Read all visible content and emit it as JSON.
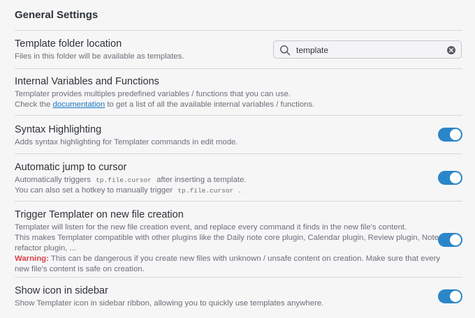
{
  "section": {
    "title": "General Settings"
  },
  "template_folder": {
    "name": "Template folder location",
    "desc": "Files in this folder will be available as templates.",
    "search_value": "template",
    "search_icon": "search-icon",
    "clear_icon": "clear-icon"
  },
  "internal_vars": {
    "name": "Internal Variables and Functions",
    "line1": "Templater provides multiples predefined variables / functions that you can use.",
    "line2_pre": "Check the ",
    "line2_link": "documentation",
    "line2_post": " to get a list of all the available internal variables / functions."
  },
  "syntax": {
    "name": "Syntax Highlighting",
    "desc": "Adds syntax highlighting for Templater commands in edit mode.",
    "enabled": true
  },
  "jump": {
    "name": "Automatic jump to cursor",
    "l1_pre": "Automatically triggers",
    "l1_code": "tp.file.cursor",
    "l1_post": "after inserting a template.",
    "l2_pre": "You can also set a hotkey to manually trigger",
    "l2_code": "tp.file.cursor",
    "l2_post": ".",
    "enabled": true
  },
  "trigger": {
    "name": "Trigger Templater on new file creation",
    "line1": "Templater will listen for the new file creation event, and replace every command it finds in the new file's content.",
    "line2": "This makes Templater compatible with other plugins like the Daily note core plugin, Calendar plugin, Review plugin, Note",
    "line3": "refactor plugin, ...",
    "warning_label": "Warning:",
    "warning_text": " This can be dangerous if you create new files with unknown / unsafe content on creation. Make sure that every",
    "line5": "new file's content is safe on creation.",
    "enabled": true
  },
  "sidebar_icon": {
    "name": "Show icon in sidebar",
    "desc": "Show Templater icon in sidebar ribbon, allowing you to quickly use templates anywhere.",
    "enabled": true
  },
  "colors": {
    "accent": "#2b86c8",
    "link": "#1a78c2",
    "warning": "#d93f49"
  }
}
